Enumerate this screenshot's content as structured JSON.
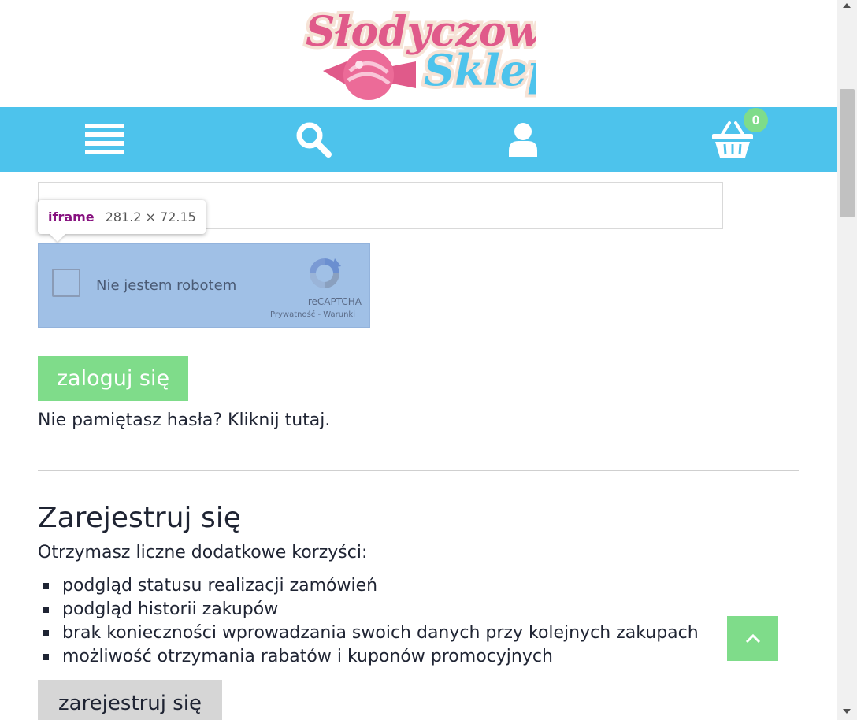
{
  "header": {
    "logo_line1": "Słodyczowo",
    "logo_line2": "Sklep"
  },
  "nav": {
    "items": [
      {
        "icon": "menu-icon"
      },
      {
        "icon": "search-icon"
      },
      {
        "icon": "user-icon"
      },
      {
        "icon": "cart-icon"
      }
    ],
    "cart_count": "0",
    "bar_color": "#4dc3ec"
  },
  "devtools_tooltip": {
    "tag": "iframe",
    "dimensions": "281.2 × 72.15"
  },
  "captcha": {
    "label": "Nie jestem robotem",
    "brand": "reCAPTCHA",
    "links": "Prywatność - Warunki"
  },
  "login": {
    "button_label": "zaloguj się",
    "forgot_text": "Nie pamiętasz hasła? Kliknij tutaj."
  },
  "register": {
    "title": "Zarejestruj się",
    "subtitle": "Otrzymasz liczne dodatkowe korzyści:",
    "benefits": [
      "podgląd statusu realizacji zamówień",
      "podgląd historii zakupów",
      "brak konieczności wprowadzania swoich danych przy kolejnych zakupach",
      "możliwość otrzymania rabatów i kuponów promocyjnych"
    ],
    "button_label": "zarejestruj się"
  },
  "colors": {
    "accent_green": "#7fdc8a",
    "nav_blue": "#4dc3ec",
    "logo_pink": "#e05a8a",
    "logo_blue": "#4dc3ec"
  }
}
